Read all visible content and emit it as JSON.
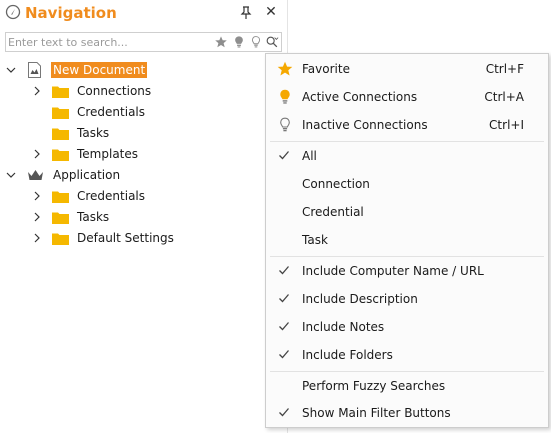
{
  "panel": {
    "title": "Navigation",
    "icons": {
      "nav": "compass-icon",
      "pin": "pin-icon",
      "close": "close-icon"
    },
    "close_glyph": "✕"
  },
  "search": {
    "placeholder": "Enter text to search...",
    "value": "",
    "buttons": [
      "star-filter-icon",
      "active-bulb-icon",
      "inactive-bulb-icon",
      "search-options-icon"
    ]
  },
  "tree": {
    "document": {
      "label": "New Document",
      "children": [
        "Connections",
        "Credentials",
        "Tasks",
        "Templates"
      ]
    },
    "application": {
      "label": "Application",
      "children": [
        "Credentials",
        "Tasks",
        "Default Settings"
      ]
    }
  },
  "menu": {
    "items": [
      {
        "label": "Favorite",
        "shortcut": "Ctrl+F",
        "icon": "star-icon"
      },
      {
        "label": "Active Connections",
        "shortcut": "Ctrl+A",
        "icon": "bulb-on-icon"
      },
      {
        "label": "Inactive Connections",
        "shortcut": "Ctrl+I",
        "icon": "bulb-off-icon"
      },
      {
        "label": "All",
        "checked": true
      },
      {
        "label": "Connection",
        "checked": false
      },
      {
        "label": "Credential",
        "checked": false
      },
      {
        "label": "Task",
        "checked": false
      },
      {
        "label": "Include Computer Name / URL",
        "checked": true
      },
      {
        "label": "Include Description",
        "checked": true
      },
      {
        "label": "Include Notes",
        "checked": true
      },
      {
        "label": "Include Folders",
        "checked": true
      },
      {
        "label": "Perform Fuzzy Searches",
        "checked": false
      },
      {
        "label": "Show Main Filter Buttons",
        "checked": true
      }
    ]
  },
  "colors": {
    "accent": "#f08c1e",
    "folder": "#f5b800",
    "star": "#f5a800",
    "text": "#1a1a1a"
  }
}
